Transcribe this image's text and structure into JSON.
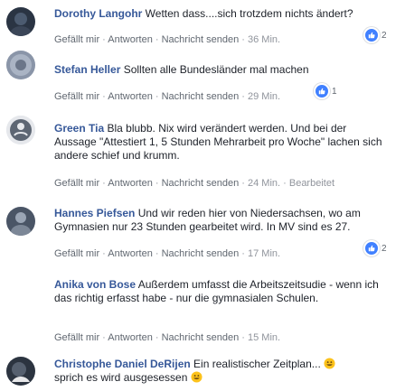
{
  "actions": {
    "like": "Gefällt mir",
    "reply": "Antworten",
    "message": "Nachricht senden",
    "sep": " · "
  },
  "comments": [
    {
      "author": "Dorothy Langohr",
      "text": "Wetten dass....sich trotzdem nichts ändert?",
      "time": "36 Min.",
      "reactions": "2"
    },
    {
      "author": "Stefan Heller",
      "text": "Sollten alle Bundesländer mal machen",
      "time": "29 Min.",
      "reactions": "1"
    },
    {
      "author": "Green Tia",
      "text": "Bla blubb. Nix wird verändert werden. Und bei der Aussage \"Attestiert 1, 5 Stunden Mehrarbeit pro Woche\" lachen sich andere schief und krumm.",
      "time": "24 Min.",
      "edited": "Bearbeitet"
    },
    {
      "author": "Hannes Piefsen",
      "text": "Und wir reden hier von Niedersachsen, wo am Gymnasien nur 23 Stunden gearbeitet wird. In MV sind es 27.",
      "time": "17 Min.",
      "reactions": "2"
    },
    {
      "author": "Anika von Bose",
      "text": "Außerdem umfasst die Arbeitszeitsudie - wenn ich das richtig erfasst habe - nur die gymnasialen Schulen.",
      "time": "15 Min."
    },
    {
      "author": "Christophe Daniel DeRijen",
      "text_part1": "Ein realistischer Zeitplan...",
      "text_part2": "sprich es wird ausgesessen"
    }
  ],
  "icons": {
    "reaction": "like-thumb-icon",
    "emoji": "smiley-emoji-icon"
  },
  "colors": {
    "author": "#365899",
    "meta": "#90949c",
    "reaction_blue": "#4080ff"
  }
}
